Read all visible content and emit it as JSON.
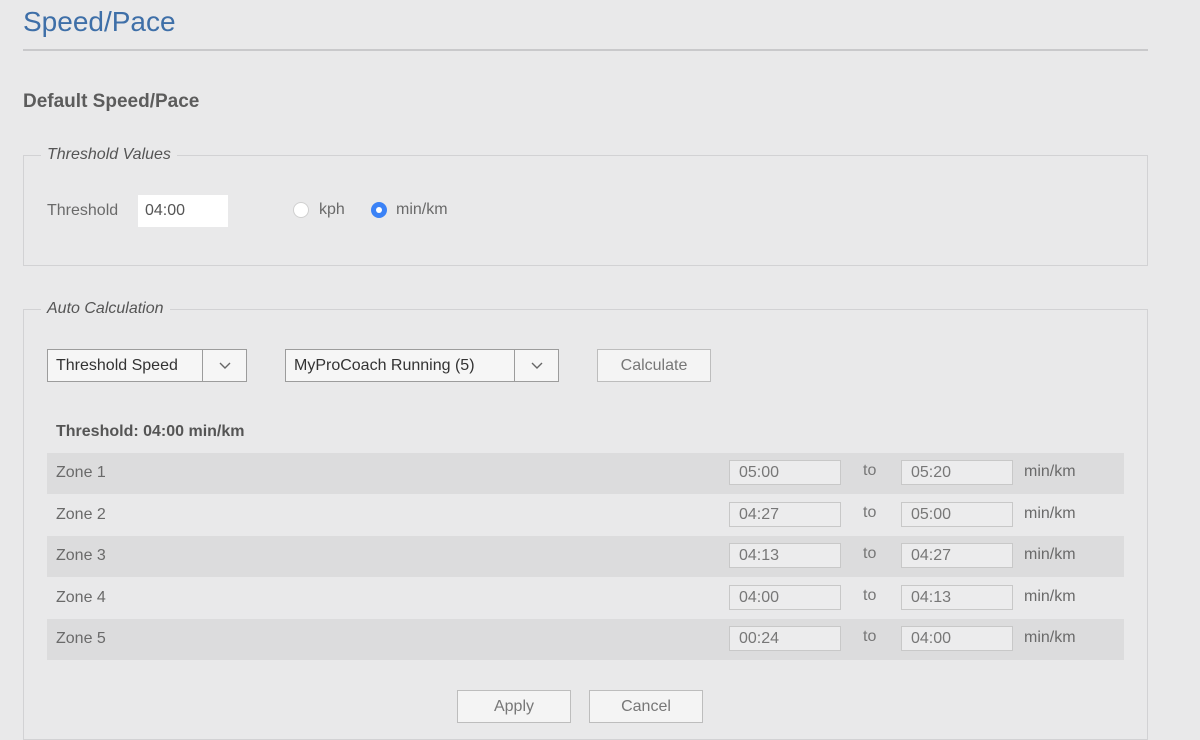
{
  "page": {
    "title": "Speed/Pace",
    "section_heading": "Default Speed/Pace"
  },
  "threshold_values": {
    "legend": "Threshold Values",
    "label": "Threshold",
    "value": "04:00",
    "units": [
      {
        "label": "kph",
        "selected": false
      },
      {
        "label": "min/km",
        "selected": true
      }
    ]
  },
  "auto_calculation": {
    "legend": "Auto Calculation",
    "method_select": "Threshold Speed",
    "model_select": "MyProCoach Running (5)",
    "calculate_label": "Calculate",
    "threshold_summary": "Threshold: 04:00 min/km",
    "to_label": "to",
    "unit_label": "min/km",
    "zones": [
      {
        "name": "Zone 1",
        "from": "05:00",
        "to": "05:20"
      },
      {
        "name": "Zone 2",
        "from": "04:27",
        "to": "05:00"
      },
      {
        "name": "Zone 3",
        "from": "04:13",
        "to": "04:27"
      },
      {
        "name": "Zone 4",
        "from": "04:00",
        "to": "04:13"
      },
      {
        "name": "Zone 5",
        "from": "00:24",
        "to": "04:00"
      }
    ]
  },
  "actions": {
    "apply_label": "Apply",
    "cancel_label": "Cancel"
  },
  "colors": {
    "title": "#3e6fa8",
    "radio_selected": "#3b82f6",
    "background": "#e9e9ea"
  },
  "icons": {
    "select_arrow": "chevron-down-icon"
  }
}
